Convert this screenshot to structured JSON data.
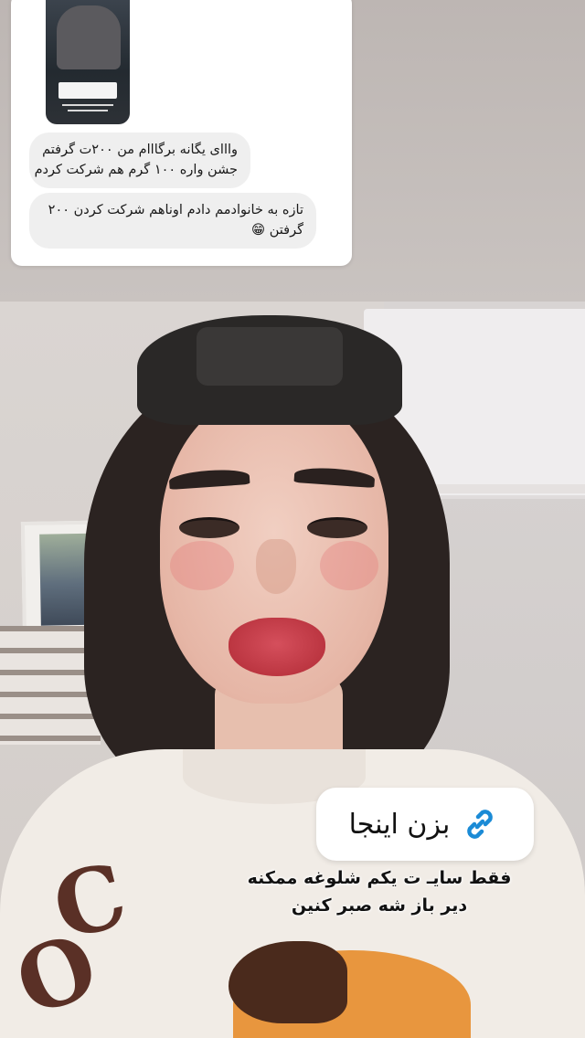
{
  "reply_card": {
    "messages": [
      {
        "lines": [
          "وااای یگانه برگااام من ۲۰۰ت گرفتم",
          "جشن واره ۱۰۰ گرم هم شرکت کردم"
        ],
        "emoji": ""
      },
      {
        "lines": [
          "تازه به خانوادمم دادم اوناهم شرکت کردن ۲۰۰",
          "گرفتن"
        ],
        "emoji": "😁"
      }
    ]
  },
  "link_sticker": {
    "label": "بزن اینجا",
    "icon": "link-icon",
    "icon_color": "#1b8bd6"
  },
  "caption": {
    "lines": [
      "فقط سایـ ت یکم شلوغه ممکنه",
      "دیر باز شه صبر کنین"
    ]
  }
}
